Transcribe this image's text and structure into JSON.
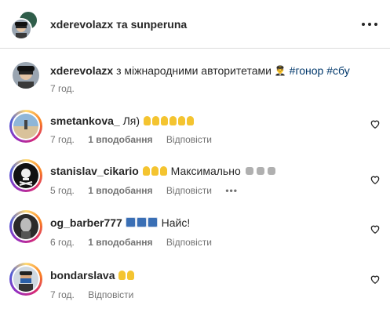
{
  "header": {
    "user1": "xderevolazx",
    "conjunction": "та",
    "user2": "sunperuna"
  },
  "post": {
    "username": "xderevolazx",
    "caption": "з міжнародними авторитетами",
    "caption_emoji": "👨‍✈️",
    "hashtags": [
      "#гонор",
      "#сбу"
    ],
    "time": "7 год."
  },
  "comments": [
    {
      "username": "smetankova_",
      "text": "Ля)",
      "emoji": "✋✋✋✋✋✋",
      "time": "7 год.",
      "likes": "1 вподобання",
      "reply": "Відповісти",
      "has_story_ring": true
    },
    {
      "username": "stanislav_cikario",
      "emoji_before": "✋✋✋",
      "text": "Максимально",
      "emoji_after": "✊✊✊",
      "time": "5 год.",
      "likes": "1 вподобання",
      "reply": "Відповісти",
      "more": "•••",
      "has_story_ring": true
    },
    {
      "username": "og_barber777",
      "emoji_before": "🪪🪪🪪",
      "text": "Найс!",
      "time": "6 год.",
      "likes": "1 вподобання",
      "reply": "Відповісти",
      "has_story_ring": true
    },
    {
      "username": "bondarslava",
      "emoji": "✋✋",
      "time": "7 год.",
      "reply": "Відповісти",
      "has_story_ring": true
    }
  ],
  "icons": {
    "more": "more-horizontal-icon",
    "like": "heart-outline-icon"
  },
  "colors": {
    "text": "#262626",
    "secondary": "#737373",
    "hashtag": "#00376b",
    "divider": "#dbdbdb"
  }
}
